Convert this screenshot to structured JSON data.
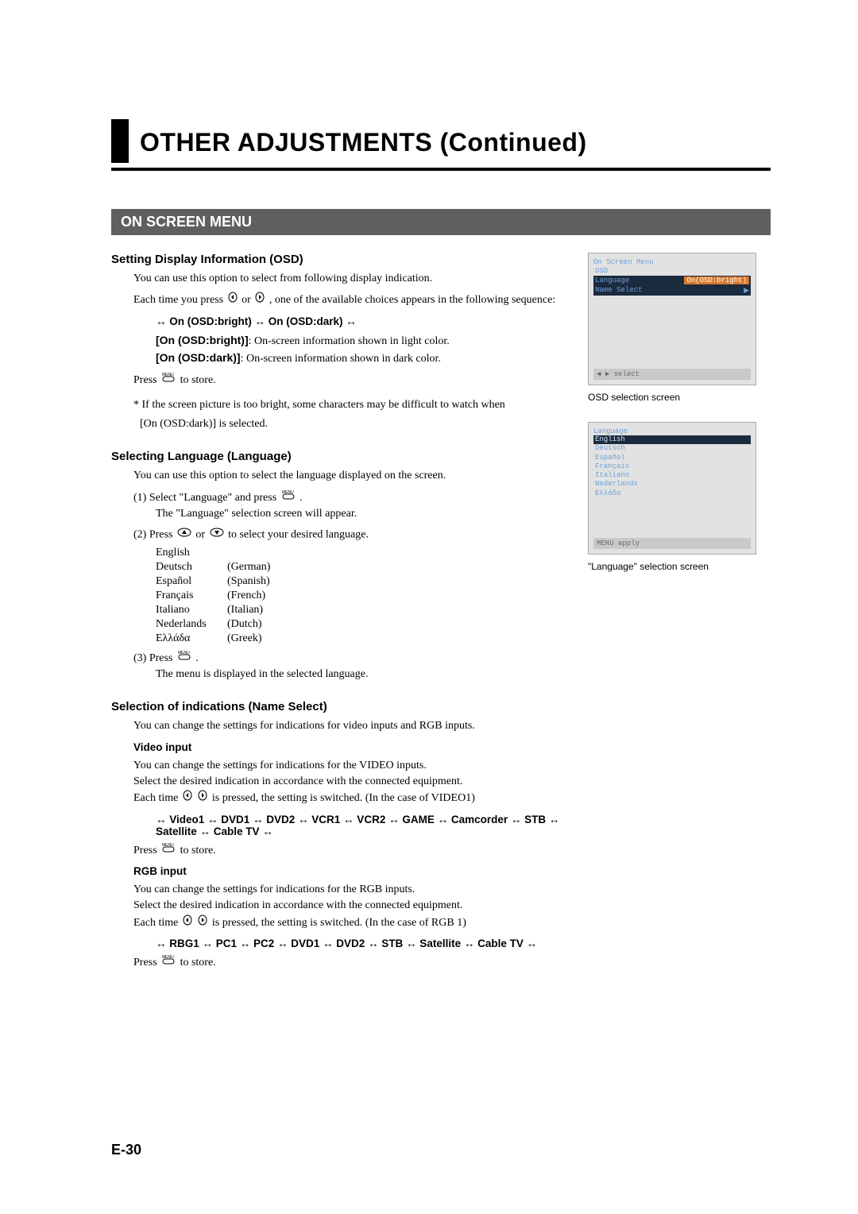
{
  "title": "OTHER ADJUSTMENTS (Continued)",
  "section": "ON SCREEN MENU",
  "osd_heading": "Setting Display Information (OSD)",
  "osd_p1": "You can use this option to select from following display indication.",
  "osd_p2a": "Each time you press ",
  "osd_p2b": ", one of the available choices appears in the following sequence:",
  "osd_seq": "↔ On (OSD:bright) ↔ On (OSD:dark) ↔",
  "osd_bright_label": "[On (OSD:bright)]",
  "osd_bright_desc": ": On-screen information shown in light color.",
  "osd_dark_label": "[On (OSD:dark)]",
  "osd_dark_desc": ":    On-screen information shown in dark color.",
  "press_store_a": "Press ",
  "press_store_b": " to store.",
  "osd_warn": "* If the screen picture is too bright, some characters may be difficult to watch when",
  "osd_warn2": "[On (OSD:dark)] is selected.",
  "lang_heading": "Selecting Language (Language)",
  "lang_p1": "You can use this option to select the language displayed on the screen.",
  "lang_step1a": "(1) Select \"Language\" and press ",
  "lang_step1b": ".",
  "lang_step1c": "The \"Language\" selection screen will appear.",
  "lang_step2a": "(2) Press ",
  "lang_step2b": " to select your desired language.",
  "languages": [
    {
      "name": "English",
      "gloss": ""
    },
    {
      "name": "Deutsch",
      "gloss": "(German)"
    },
    {
      "name": "Español",
      "gloss": "(Spanish)"
    },
    {
      "name": "Français",
      "gloss": "(French)"
    },
    {
      "name": "Italiano",
      "gloss": "(Italian)"
    },
    {
      "name": "Nederlands",
      "gloss": "(Dutch)"
    },
    {
      "name": "Ελλάδα",
      "gloss": "(Greek)"
    }
  ],
  "lang_step3a": "(3) Press ",
  "lang_step3b": ".",
  "lang_step3c": "The menu is displayed in the selected language.",
  "name_heading": "Selection of indications (Name Select)",
  "name_p1": "You can change the settings for indications for video inputs and RGB inputs.",
  "video_label": "Video input",
  "video_p1": "You can change the settings for indications for the VIDEO inputs.",
  "video_p2": "Select the desired indication in accordance with the connected equipment.",
  "video_p3a": "Each time ",
  "video_p3b": " is pressed, the setting is switched. (In the case of VIDEO1)",
  "video_seq": "↔ Video1 ↔  DVD1  ↔ DVD2  ↔  VCR1  ↔ VCR2 ↔ GAME ↔ Camcorder ↔  STB  ↔ Satellite ↔ Cable TV ↔",
  "rgb_label": "RGB input",
  "rgb_p1": "You can change the settings for indications for the RGB inputs.",
  "rgb_p2": "Select the desired indication in accordance with the connected equipment.",
  "rgb_p3a": "Each time ",
  "rgb_p3b": " is pressed, the setting is switched. (In the case of RGB 1)",
  "rgb_seq": "↔ RBG1 ↔  PC1  ↔ PC2 ↔ DVD1  ↔ DVD2  ↔  STB  ↔ Satellite ↔ Cable TV ↔",
  "page_no": "E-30",
  "shot1": {
    "title": "On Screen Menu",
    "rows": [
      {
        "k": "OSD",
        "v": ""
      },
      {
        "k": "Language",
        "v": "On(OSD:bright)"
      },
      {
        "k": "Name Select",
        "v": "▶"
      }
    ],
    "footer": "◀ ▶  select",
    "caption": "OSD selection screen"
  },
  "shot2": {
    "title": "Language",
    "list": [
      "English",
      "Deutsch",
      "Español",
      "Français",
      "Italiano",
      "Nederlands",
      "Ελλάδα"
    ],
    "footer": "MENU  apply",
    "caption": "\"Language\" selection screen"
  }
}
